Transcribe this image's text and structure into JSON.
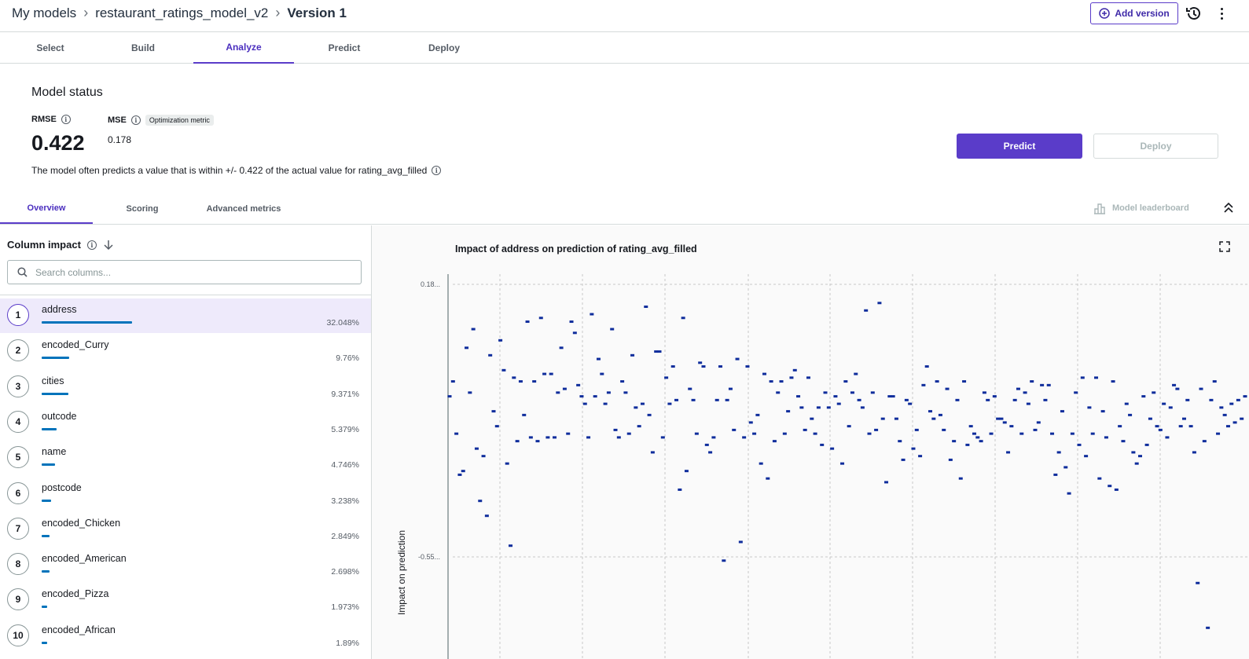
{
  "breadcrumb": {
    "items": [
      "My models",
      "restaurant_ratings_model_v2"
    ],
    "current": "Version 1"
  },
  "header": {
    "add_version_label": "Add version",
    "history_icon": "history-icon",
    "more_icon": "more-vertical-icon"
  },
  "main_tabs": [
    "Select",
    "Build",
    "Analyze",
    "Predict",
    "Deploy"
  ],
  "main_tabs_active": "Analyze",
  "model_status": {
    "title": "Model status",
    "rmse_label": "RMSE",
    "rmse_value": "0.422",
    "mse_label": "MSE",
    "mse_badge": "Optimization metric",
    "mse_value": "0.178",
    "description": "The model often predicts a value that is within +/- 0.422 of the actual value for rating_avg_filled",
    "predict_label": "Predict",
    "deploy_label": "Deploy"
  },
  "sub_tabs": [
    "Overview",
    "Scoring",
    "Advanced metrics"
  ],
  "sub_tabs_active": "Overview",
  "leaderboard_label": "Model leaderboard",
  "column_impact": {
    "title": "Column impact",
    "search_placeholder": "Search columns...",
    "columns": [
      {
        "rank": "1",
        "name": "address",
        "pct": "32.048%",
        "value": 32.048
      },
      {
        "rank": "2",
        "name": "encoded_Curry",
        "pct": "9.76%",
        "value": 9.76
      },
      {
        "rank": "3",
        "name": "cities",
        "pct": "9.371%",
        "value": 9.371
      },
      {
        "rank": "4",
        "name": "outcode",
        "pct": "5.379%",
        "value": 5.379
      },
      {
        "rank": "5",
        "name": "name",
        "pct": "4.746%",
        "value": 4.746
      },
      {
        "rank": "6",
        "name": "postcode",
        "pct": "3.238%",
        "value": 3.238
      },
      {
        "rank": "7",
        "name": "encoded_Chicken",
        "pct": "2.849%",
        "value": 2.849
      },
      {
        "rank": "8",
        "name": "encoded_American",
        "pct": "2.698%",
        "value": 2.698
      },
      {
        "rank": "9",
        "name": "encoded_Pizza",
        "pct": "1.973%",
        "value": 1.973
      },
      {
        "rank": "10",
        "name": "encoded_African",
        "pct": "1.89%",
        "value": 1.89
      }
    ]
  },
  "colors": {
    "accent": "#5a3cc9",
    "bar": "#0073bb",
    "point": "#0f2d9c",
    "grid": "#c8c8c8"
  },
  "chart_data": {
    "type": "scatter",
    "title": "Impact of address on prediction of rating_avg_filled",
    "ylabel": "Impact on prediction",
    "y_tick_labels": [
      "0.18...",
      "-0.55..."
    ],
    "y_ticks": [
      0.18,
      -0.55
    ],
    "ylim": [
      -0.82,
      0.18
    ],
    "grid": true,
    "series": [
      {
        "values": [
          -0.12,
          -0.08,
          -0.22,
          -0.33,
          -0.32,
          0.01,
          -0.11,
          0.06,
          -0.26,
          -0.4,
          -0.28,
          -0.44,
          -0.01,
          -0.16,
          -0.2,
          0.03,
          -0.05,
          -0.3,
          -0.52,
          -0.07,
          -0.24,
          -0.08,
          -0.17,
          0.08,
          -0.23,
          -0.08,
          -0.24,
          0.09,
          -0.06,
          -0.23,
          -0.06,
          -0.23,
          -0.11,
          0.01,
          -0.1,
          -0.22,
          0.08,
          0.05,
          -0.09,
          -0.12,
          -0.14,
          -0.23,
          0.1,
          -0.12,
          -0.02,
          -0.06,
          -0.14,
          -0.11,
          0.06,
          -0.21,
          -0.23,
          -0.08,
          -0.11,
          -0.22,
          -0.01,
          -0.15,
          -0.2,
          -0.14,
          0.12,
          -0.17,
          -0.27,
          0.0,
          0.0,
          -0.23,
          -0.07,
          -0.14,
          -0.04,
          -0.13,
          -0.37,
          0.09,
          -0.32,
          -0.1,
          -0.13,
          -0.22,
          -0.03,
          -0.04,
          -0.25,
          -0.27,
          -0.23,
          -0.13,
          -0.04,
          -0.56,
          -0.13,
          -0.1,
          -0.21,
          -0.02,
          -0.51,
          -0.23,
          -0.04,
          -0.19,
          -0.22,
          -0.17,
          -0.3,
          -0.06,
          -0.34,
          -0.08,
          -0.24,
          -0.11,
          -0.08,
          -0.22,
          -0.16,
          -0.07,
          -0.05,
          -0.12,
          -0.15,
          -0.21,
          -0.07,
          -0.18,
          -0.22,
          -0.15,
          -0.25,
          -0.11,
          -0.15,
          -0.26,
          -0.12,
          -0.14,
          -0.3,
          -0.08,
          -0.2,
          -0.11,
          -0.06,
          -0.13,
          -0.15,
          0.11,
          -0.22,
          -0.11,
          -0.21,
          0.13,
          -0.18,
          -0.35,
          -0.12,
          -0.12,
          -0.18,
          -0.24,
          -0.29,
          -0.13,
          -0.14,
          -0.26,
          -0.21,
          -0.28,
          -0.09,
          -0.04,
          -0.16,
          -0.18,
          -0.08,
          -0.17,
          -0.21,
          -0.1,
          -0.29,
          -0.24,
          -0.13,
          -0.34,
          -0.08,
          -0.25,
          -0.2,
          -0.22,
          -0.23,
          -0.24,
          -0.11,
          -0.13,
          -0.22,
          -0.12,
          -0.18,
          -0.18,
          -0.19,
          -0.27,
          -0.2,
          -0.13,
          -0.1,
          -0.22,
          -0.11,
          -0.14,
          -0.08,
          -0.21,
          -0.19,
          -0.09,
          -0.13,
          -0.09,
          -0.22,
          -0.33,
          -0.27,
          -0.16,
          -0.31,
          -0.38,
          -0.22,
          -0.11,
          -0.25,
          -0.07,
          -0.28,
          -0.15,
          -0.22,
          -0.07,
          -0.34,
          -0.16,
          -0.23,
          -0.36,
          -0.08,
          -0.37,
          -0.2,
          -0.24,
          -0.14,
          -0.17,
          -0.27,
          -0.3,
          -0.28,
          -0.12,
          -0.25,
          -0.18,
          -0.11,
          -0.2,
          -0.21,
          -0.14,
          -0.23,
          -0.15,
          -0.09,
          -0.1,
          -0.2,
          -0.18,
          -0.13,
          -0.2,
          -0.27,
          -0.62,
          -0.1,
          -0.24,
          -0.74,
          -0.13,
          -0.08,
          -0.22,
          -0.15,
          -0.17,
          -0.2,
          -0.14,
          -0.19,
          -0.13,
          -0.18,
          -0.12
        ]
      }
    ]
  }
}
